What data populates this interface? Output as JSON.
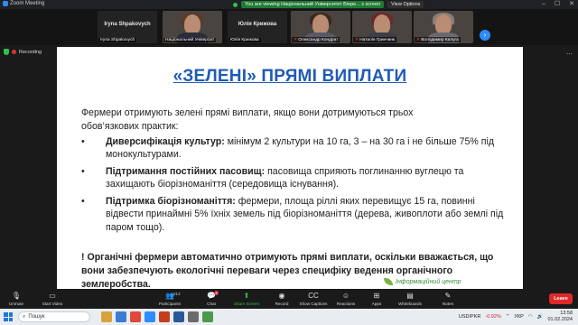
{
  "window": {
    "title": "Zoom Meeting"
  },
  "share_banner": {
    "text": "You are viewing Національний Університет Біоре... s screen",
    "view_options": "View Options"
  },
  "participants": [
    {
      "big_name": "Iryna Shpakovych",
      "label": "Iryna Shpakovych",
      "video": false,
      "muted": false
    },
    {
      "big_name": "",
      "label": "Національний Університ",
      "video": true,
      "muted": false
    },
    {
      "big_name": "Юлія Крижова",
      "label": "Юлія Крижова",
      "video": false,
      "muted": false
    },
    {
      "big_name": "",
      "label": "Олександр Кондрат",
      "video": true,
      "muted": true
    },
    {
      "big_name": "",
      "label": "Наталія Гринчинк",
      "video": true,
      "muted": true
    },
    {
      "big_name": "",
      "label": "Володимир Калуга",
      "video": true,
      "muted": true
    }
  ],
  "indicators": {
    "recording": "Recording"
  },
  "slide": {
    "title": "«ЗЕЛЕНІ» ПРЯМІ ВИПЛАТИ",
    "intro": "Фермери отримують зелені прямі виплати, якщо вони дотримуються трьох обов’язкових практик:",
    "bullets": [
      {
        "head": "Диверсифікація культур:",
        "text": " мінімум 2 культури на 10 га, 3 – на 30 га і не більше 75% під монокультурами."
      },
      {
        "head": "Підтримання постійних пасовищ:",
        "text": " пасовища сприяють поглинанню вуглецю та захищають біорізноманіття (середовища існування)."
      },
      {
        "head": "Підтримка біорізноманіття:",
        "text": " фермери, площа ріллі яких перевищує 15 га, повинні відвести принаймні 5% їхніх земель під біорізноманіття (дерева, живоплоти або землі під паром тощо)."
      }
    ],
    "note": "! Органічні фермери автоматично отримують прямі виплати, оскільки вважається, що вони забезпечують екологічні переваги через специфіку ведення органічного землеробства.",
    "logo_text": "Інформаційний центр"
  },
  "controls": {
    "unmute": "Unmute",
    "start_video": "Start Video",
    "participants": "Participants",
    "participants_count": "212",
    "chat": "Chat",
    "chat_badge": "8",
    "share_screen": "Share Screen",
    "record": "Record",
    "show_captions": "Show Captions",
    "reactions": "Reactions",
    "apps": "Apps",
    "whiteboards": "Whiteboards",
    "notes": "Notes",
    "leave": "Leave"
  },
  "taskbar": {
    "search_placeholder": "Пошук",
    "ticker": "USD/PKR",
    "ticker_change": "-0.92%",
    "language": "УКР",
    "time": "13:58",
    "date": "01.02.2024"
  }
}
